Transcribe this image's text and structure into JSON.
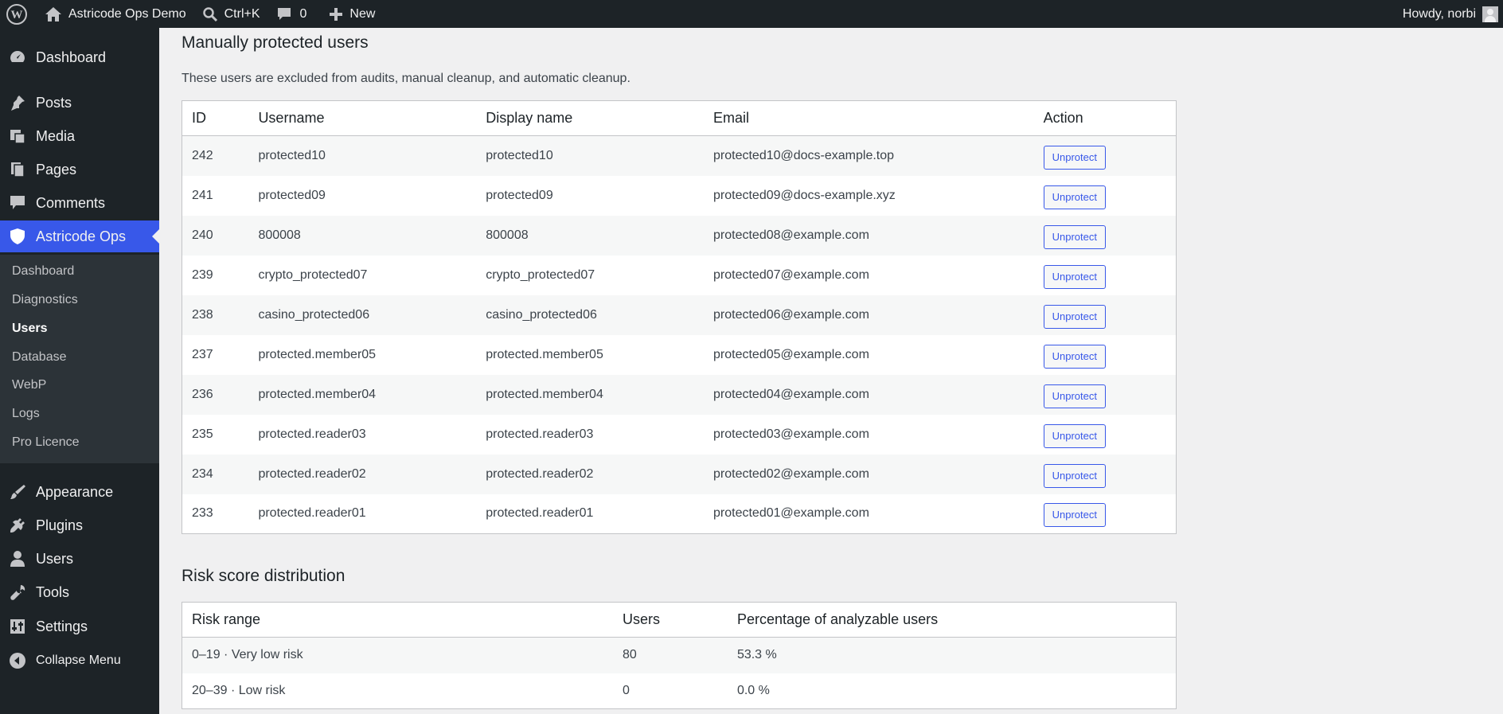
{
  "adminbar": {
    "site_name": "Astricode Ops Demo",
    "search_shortcut": "Ctrl+K",
    "comments_count": "0",
    "new_label": "New",
    "howdy": "Howdy, norbi"
  },
  "sidebar": {
    "items": [
      {
        "label": "Dashboard",
        "icon": "dashboard-icon"
      },
      {
        "label": "Posts",
        "icon": "pin-icon"
      },
      {
        "label": "Media",
        "icon": "media-icon"
      },
      {
        "label": "Pages",
        "icon": "pages-icon"
      },
      {
        "label": "Comments",
        "icon": "comment-icon"
      },
      {
        "label": "Astricode Ops",
        "icon": "shield-icon"
      },
      {
        "label": "Appearance",
        "icon": "brush-icon"
      },
      {
        "label": "Plugins",
        "icon": "plug-icon"
      },
      {
        "label": "Users",
        "icon": "user-icon"
      },
      {
        "label": "Tools",
        "icon": "wrench-icon"
      },
      {
        "label": "Settings",
        "icon": "sliders-icon"
      },
      {
        "label": "Collapse Menu",
        "icon": "collapse-icon"
      }
    ],
    "submenu": [
      {
        "label": "Dashboard"
      },
      {
        "label": "Diagnostics"
      },
      {
        "label": "Users"
      },
      {
        "label": "Database"
      },
      {
        "label": "WebP"
      },
      {
        "label": "Logs"
      },
      {
        "label": "Pro Licence"
      }
    ]
  },
  "protected": {
    "title": "Manually protected users",
    "description": "These users are excluded from audits, manual cleanup, and automatic cleanup.",
    "columns": [
      "ID",
      "Username",
      "Display name",
      "Email",
      "Action"
    ],
    "button_label": "Unprotect",
    "rows": [
      {
        "id": "242",
        "username": "protected10",
        "display": "protected10",
        "email": "protected10@docs-example.top"
      },
      {
        "id": "241",
        "username": "protected09",
        "display": "protected09",
        "email": "protected09@docs-example.xyz"
      },
      {
        "id": "240",
        "username": "800008",
        "display": "800008",
        "email": "protected08@example.com"
      },
      {
        "id": "239",
        "username": "crypto_protected07",
        "display": "crypto_protected07",
        "email": "protected07@example.com"
      },
      {
        "id": "238",
        "username": "casino_protected06",
        "display": "casino_protected06",
        "email": "protected06@example.com"
      },
      {
        "id": "237",
        "username": "protected.member05",
        "display": "protected.member05",
        "email": "protected05@example.com"
      },
      {
        "id": "236",
        "username": "protected.member04",
        "display": "protected.member04",
        "email": "protected04@example.com"
      },
      {
        "id": "235",
        "username": "protected.reader03",
        "display": "protected.reader03",
        "email": "protected03@example.com"
      },
      {
        "id": "234",
        "username": "protected.reader02",
        "display": "protected.reader02",
        "email": "protected02@example.com"
      },
      {
        "id": "233",
        "username": "protected.reader01",
        "display": "protected.reader01",
        "email": "protected01@example.com"
      }
    ]
  },
  "risk": {
    "title": "Risk score distribution",
    "columns": [
      "Risk range",
      "Users",
      "Percentage of analyzable users"
    ],
    "rows": [
      {
        "range": "0–19 · Very low risk",
        "users": "80",
        "pct": "53.3 %"
      },
      {
        "range": "20–39 · Low risk",
        "users": "0",
        "pct": "0.0 %"
      }
    ]
  },
  "colors": {
    "admin_bg": "#1d2327",
    "accent": "#3858e9",
    "page_bg": "#f0f0f1"
  }
}
